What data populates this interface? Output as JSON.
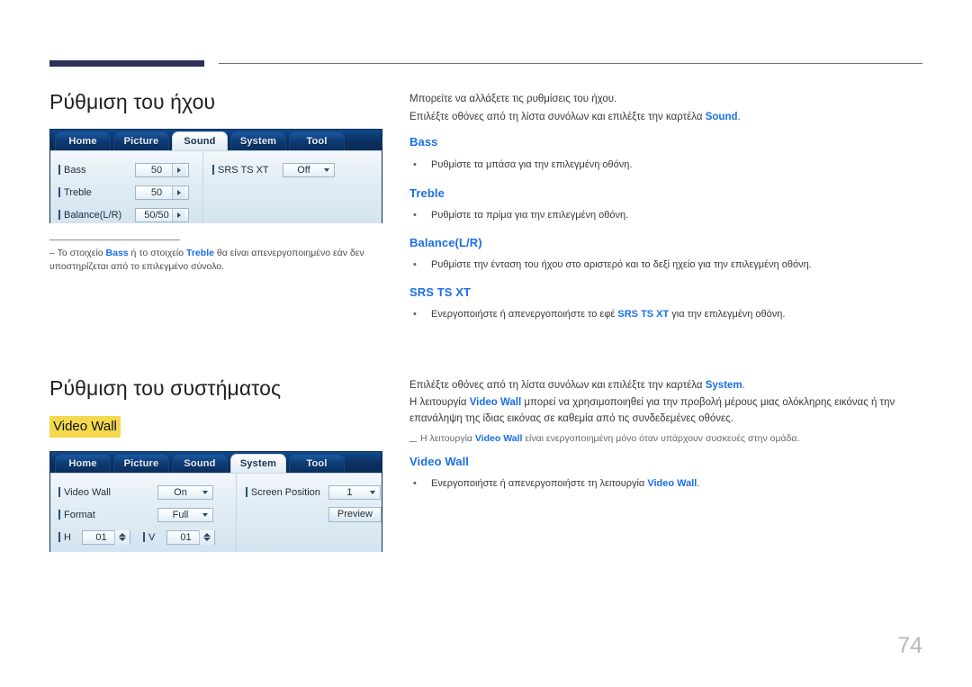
{
  "page": {
    "number": "74",
    "accent_blue": "#1a6fe8",
    "highlight_yellow": "#f4d84e",
    "header_bar_color": "#2e3159"
  },
  "sections": [
    {
      "title": "Ρύθμιση του ήχου",
      "device_ui": {
        "tabs": [
          {
            "label": "Home",
            "active": false
          },
          {
            "label": "Picture",
            "active": false
          },
          {
            "label": "Sound",
            "active": true
          },
          {
            "label": "System",
            "active": false
          },
          {
            "label": "Tool",
            "active": false
          }
        ],
        "left_rows": [
          {
            "label": "Bass",
            "value": "50",
            "control": "stepper-arrow"
          },
          {
            "label": "Treble",
            "value": "50",
            "control": "stepper-arrow"
          },
          {
            "label": "Balance(L/R)",
            "value": "50/50",
            "control": "stepper-arrow"
          }
        ],
        "right_rows": [
          {
            "label": "SRS TS XT",
            "value": "Off",
            "control": "dropdown"
          }
        ]
      },
      "footnote": {
        "dash": "–",
        "text_1": "Το στοιχείο ",
        "bold_1": "Bass",
        "text_2": " ή το στοιχείο ",
        "bold_2": "Treble",
        "text_3": " θα είναι απενεργοποιημένο εάν δεν υποστηρίζεται από το επιλεγμένο σύνολο."
      },
      "intro_paragraphs": [
        {
          "text": "Μπορείτε να αλλάξετε τις ρυθμίσεις του ήχου.",
          "link": "",
          "tail": ""
        },
        {
          "text": "Επιλέξτε οθόνες από τη λίστα συνόλων και επιλέξτε την καρτέλα ",
          "link": "Sound",
          "tail": "."
        }
      ],
      "items": [
        {
          "heading": "Bass",
          "bullet": "Ρυθμίστε τα μπάσα για την επιλεγμένη οθόνη."
        },
        {
          "heading": "Treble",
          "bullet": "Ρυθμίστε τα πρίμα για την επιλεγμένη οθόνη."
        },
        {
          "heading": "Balance(L/R)",
          "bullet": "Ρυθμίστε την ένταση του ήχου στο αριστερό και το δεξί ηχείο για την επιλεγμένη οθόνη."
        },
        {
          "heading": "SRS TS XT",
          "bullet_pre": "Ενεργοποιήστε ή απενεργοποιήστε το εφέ ",
          "bullet_link": "SRS TS XT",
          "bullet_post": " για την επιλεγμένη οθόνη."
        }
      ]
    },
    {
      "title": "Ρύθμιση του συστήματος",
      "highlight_label": "Video Wall",
      "device_ui": {
        "tabs": [
          {
            "label": "Home",
            "active": false
          },
          {
            "label": "Picture",
            "active": false
          },
          {
            "label": "Sound",
            "active": false
          },
          {
            "label": "System",
            "active": true
          },
          {
            "label": "Tool",
            "active": false
          }
        ],
        "left_rows": [
          {
            "label": "Video Wall",
            "value": "On",
            "control": "dropdown"
          },
          {
            "label": "Format",
            "value": "Full",
            "control": "dropdown"
          }
        ],
        "hv_row": [
          {
            "label": "H",
            "value": "01",
            "control": "spinner"
          },
          {
            "label": "V",
            "value": "01",
            "control": "spinner"
          }
        ],
        "right_rows": [
          {
            "label": "Screen Position",
            "value": "1",
            "control": "dropdown"
          }
        ],
        "right_button": "Preview"
      },
      "paragraphs": {
        "p1_pre": "Επιλέξτε οθόνες από τη λίστα συνόλων και επιλέξτε την καρτέλα ",
        "p1_link": "System",
        "p1_post": ".",
        "p2_pre": "Η λειτουργία ",
        "p2_link": "Video Wall",
        "p2_post": " μπορεί να χρησιμοποιηθεί για την προβολή μέρους μιας ολόκληρης εικόνας ή την επανάληψη της ίδιας εικόνας σε καθεμία από τις συνδεδεμένες οθόνες.",
        "note_pre": "Η λειτουργία ",
        "note_link": "Video Wall",
        "note_post": " είναι ενεργοποιημένη μόνο όταν υπάρχουν συσκευές στην ομάδα."
      },
      "items": [
        {
          "heading": "Video Wall",
          "bullet_pre": "Ενεργοποιήστε ή απενεργοποιήστε τη λειτουργία ",
          "bullet_link": "Video Wall",
          "bullet_post": "."
        }
      ]
    }
  ]
}
